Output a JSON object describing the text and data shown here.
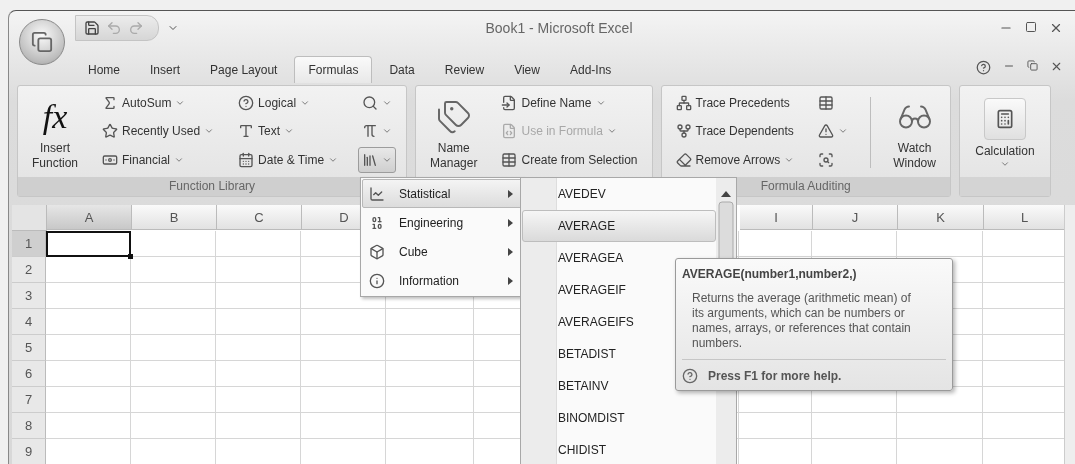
{
  "window": {
    "title": "Book1 - Microsoft Excel"
  },
  "tabs": [
    {
      "label": "Home",
      "selected": false
    },
    {
      "label": "Insert",
      "selected": false
    },
    {
      "label": "Page Layout",
      "selected": false
    },
    {
      "label": "Formulas",
      "selected": true
    },
    {
      "label": "Data",
      "selected": false
    },
    {
      "label": "Review",
      "selected": false
    },
    {
      "label": "View",
      "selected": false
    },
    {
      "label": "Add-Ins",
      "selected": false
    }
  ],
  "ribbon": {
    "groups": [
      {
        "label": "Function Library",
        "columns": [
          {
            "kind": "large",
            "buttons": [
              {
                "label": "Insert Function",
                "glyph": "fx",
                "dropdown": false,
                "disabled": false,
                "pressed": false
              }
            ]
          },
          {
            "kind": "stack",
            "buttons": [
              {
                "label": "AutoSum",
                "dropdown": true,
                "disabled": false,
                "pressed": false
              },
              {
                "label": "Recently Used",
                "dropdown": true,
                "disabled": false,
                "pressed": false
              },
              {
                "label": "Financial",
                "dropdown": true,
                "disabled": false,
                "pressed": false
              }
            ]
          },
          {
            "kind": "stack",
            "buttons": [
              {
                "label": "Logical",
                "dropdown": true,
                "disabled": false,
                "pressed": false
              },
              {
                "label": "Text",
                "dropdown": true,
                "disabled": false,
                "pressed": false
              },
              {
                "label": "Date & Time",
                "dropdown": true,
                "disabled": false,
                "pressed": false
              }
            ]
          },
          {
            "kind": "stack",
            "buttons": [
              {
                "dropdown": true,
                "disabled": false,
                "pressed": false
              },
              {
                "dropdown": true,
                "disabled": false,
                "pressed": false
              },
              {
                "dropdown": true,
                "disabled": false,
                "pressed": true
              }
            ]
          }
        ]
      },
      {
        "columns": [
          {
            "kind": "large",
            "buttons": [
              {
                "label": "Name Manager",
                "dropdown": false,
                "disabled": false,
                "pressed": false
              }
            ]
          },
          {
            "kind": "stack",
            "buttons": [
              {
                "label": "Define Name",
                "dropdown": true,
                "disabled": false,
                "pressed": false
              },
              {
                "label": "Use in Formula",
                "dropdown": true,
                "disabled": true,
                "pressed": false
              },
              {
                "label": "Create from Selection",
                "dropdown": false,
                "disabled": false,
                "pressed": false
              }
            ]
          }
        ]
      },
      {
        "label": "Formula Auditing",
        "columns": [
          {
            "kind": "stack",
            "buttons": [
              {
                "label": "Trace Precedents",
                "dropdown": false,
                "disabled": false,
                "pressed": false
              },
              {
                "label": "Trace Dependents",
                "dropdown": false,
                "disabled": false,
                "pressed": false
              },
              {
                "label": "Remove Arrows",
                "dropdown": true,
                "disabled": false,
                "pressed": false
              }
            ]
          },
          {
            "kind": "stack",
            "buttons": [
              {
                "dropdown": false,
                "disabled": false,
                "pressed": false
              },
              {
                "dropdown": true,
                "disabled": false,
                "pressed": false
              },
              {
                "dropdown": false,
                "disabled": false,
                "pressed": false
              }
            ]
          },
          {
            "kind": "separator"
          },
          {
            "kind": "large",
            "buttons": [
              {
                "label": "Watch Window",
                "dropdown": false,
                "disabled": false,
                "pressed": false
              }
            ]
          }
        ]
      },
      {
        "columns": [
          {
            "kind": "large",
            "buttons": [
              {
                "label": "Calculation",
                "dropdown": true,
                "disabled": false,
                "pressed": false
              }
            ]
          }
        ]
      }
    ]
  },
  "category_menu": [
    {
      "label": "Statistical",
      "selected": true
    },
    {
      "label": "Engineering",
      "selected": false
    },
    {
      "label": "Cube",
      "selected": false
    },
    {
      "label": "Information",
      "selected": false
    }
  ],
  "function_list": [
    {
      "label": "AVEDEV",
      "selected": false
    },
    {
      "label": "AVERAGE",
      "selected": true
    },
    {
      "label": "AVERAGEA",
      "selected": false
    },
    {
      "label": "AVERAGEIF",
      "selected": false
    },
    {
      "label": "AVERAGEIFS",
      "selected": false
    },
    {
      "label": "BETADIST",
      "selected": false
    },
    {
      "label": "BETAINV",
      "selected": false
    },
    {
      "label": "BINOMDIST",
      "selected": false
    },
    {
      "label": "CHIDIST",
      "selected": false
    }
  ],
  "tooltip": {
    "title": "AVERAGE(number1,number2,)",
    "description": "Returns the average (arithmetic mean) of its arguments, which can be numbers or names, arrays, or references that contain numbers.",
    "help": "Press F1 for more help."
  },
  "sheet": {
    "columns": [
      {
        "label": "A",
        "selected": true
      },
      {
        "label": "B",
        "selected": false
      },
      {
        "label": "C",
        "selected": false
      },
      {
        "label": "D",
        "selected": false
      },
      {
        "label": "I",
        "selected": false
      },
      {
        "label": "J",
        "selected": false
      },
      {
        "label": "K",
        "selected": false
      },
      {
        "label": "L",
        "selected": false
      }
    ],
    "rows": [
      {
        "label": "1",
        "selected": true
      },
      {
        "label": "2",
        "selected": false
      },
      {
        "label": "3",
        "selected": false
      },
      {
        "label": "4",
        "selected": false
      },
      {
        "label": "5",
        "selected": false
      },
      {
        "label": "6",
        "selected": false
      },
      {
        "label": "7",
        "selected": false
      },
      {
        "label": "8",
        "selected": false
      },
      {
        "label": "9",
        "selected": false
      }
    ]
  }
}
